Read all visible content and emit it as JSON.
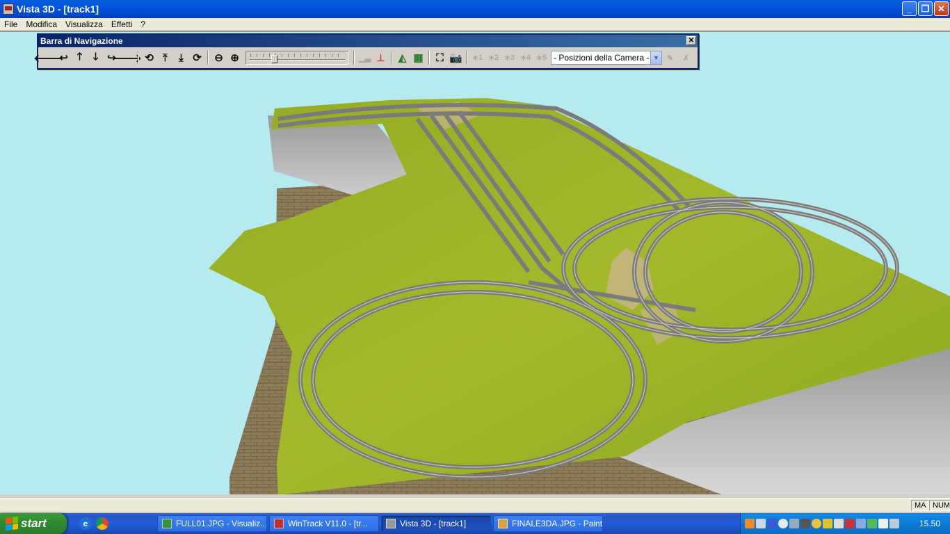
{
  "window": {
    "title": "Vista 3D - [track1]",
    "icon": "vista3d-app-icon"
  },
  "menu": [
    "File",
    "Modifica",
    "Visualizza",
    "Effetti",
    "?"
  ],
  "nav_toolbar": {
    "title": "Barra di Navigazione",
    "close_glyph": "✕",
    "zoom_level": 0.25,
    "camera_select": {
      "value": "- Posizioni della Camera -"
    },
    "preset_buttons": [
      "1",
      "2",
      "3",
      "4",
      "5"
    ],
    "buttons": [
      "arrow-left-icon",
      "turn-left-icon",
      "arrow-up-icon",
      "arrow-down-icon",
      "turn-right-icon",
      "arrow-right-icon",
      "orbit-icon",
      "tilt-up-icon",
      "tilt-down-icon",
      "rotate-view-icon",
      "zoom-out-icon",
      "zoom-in-icon",
      "terrain-icon",
      "track-height-icon",
      "landscape-icon",
      "grid-icon",
      "fit-view-icon",
      "camera-icon",
      "camera-preset-1-icon",
      "camera-preset-2-icon",
      "camera-preset-3-icon",
      "camera-preset-4-icon",
      "camera-preset-5-icon",
      "save-camera-icon",
      "delete-camera-icon"
    ]
  },
  "status": {
    "caps": "MA",
    "num": "NUM"
  },
  "taskbar": {
    "start_label": "start",
    "tasks": [
      {
        "label": "FULL01.JPG - Visualiz...",
        "active": false
      },
      {
        "label": "WinTrack  V11.0 - [tr...",
        "active": false
      },
      {
        "label": "Vista 3D - [track1]",
        "active": true
      },
      {
        "label": "FINALE3DA.JPG - Paint",
        "active": false
      }
    ],
    "clock": "15.50"
  },
  "colors": {
    "sky": "#b4eaf0",
    "grass": "#8fae22",
    "brick": "#8a7a58",
    "rail": "#7a7a7a"
  }
}
